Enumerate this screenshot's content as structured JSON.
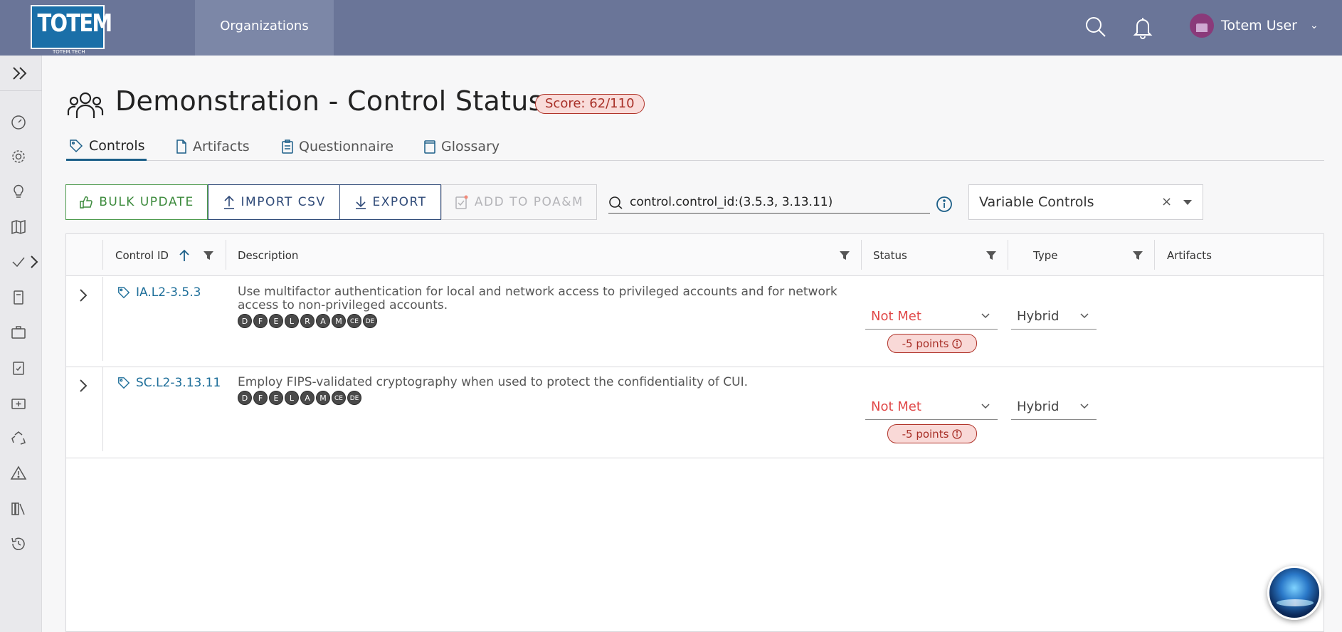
{
  "header": {
    "logo_text": "TOTEM",
    "logo_sub": "TOTEM.TECH",
    "nav_organizations": "Organizations",
    "user_name": "Totem User"
  },
  "page": {
    "title": "Demonstration - Control Status",
    "score": "Score: 62/110"
  },
  "tabs": [
    {
      "label": "Controls"
    },
    {
      "label": "Artifacts"
    },
    {
      "label": "Questionnaire"
    },
    {
      "label": "Glossary"
    }
  ],
  "toolbar": {
    "bulk_update": "BULK UPDATE",
    "import_csv": "IMPORT CSV",
    "export": "EXPORT",
    "add_poam": "ADD TO POA&M",
    "search_value": "control.control_id:(3.5.3, 3.13.11)",
    "filter_select": "Variable Controls",
    "clear": "×"
  },
  "table": {
    "columns": {
      "control_id": "Control ID",
      "description": "Description",
      "status": "Status",
      "type": "Type",
      "artifacts": "Artifacts"
    },
    "rows": [
      {
        "control_id": "IA.L2-3.5.3",
        "description": "Use multifactor authentication for local and network access to privileged accounts and for network access to non-privileged accounts.",
        "badges": [
          "D",
          "F",
          "E",
          "L",
          "R",
          "A",
          "M",
          "CE",
          "DE"
        ],
        "status": "Not Met",
        "points": "-5 points",
        "type": "Hybrid"
      },
      {
        "control_id": "SC.L2-3.13.11",
        "description": "Employ FIPS-validated cryptography when used to protect the confidentiality of CUI.",
        "badges": [
          "D",
          "F",
          "E",
          "L",
          "A",
          "M",
          "CE",
          "DE"
        ],
        "status": "Not Met",
        "points": "-5 points",
        "type": "Hybrid"
      }
    ]
  },
  "colors": {
    "topbar": "#6a7598",
    "accent": "#1f6f9a",
    "not_met": "#e04848",
    "success": "#3c8a3c"
  }
}
